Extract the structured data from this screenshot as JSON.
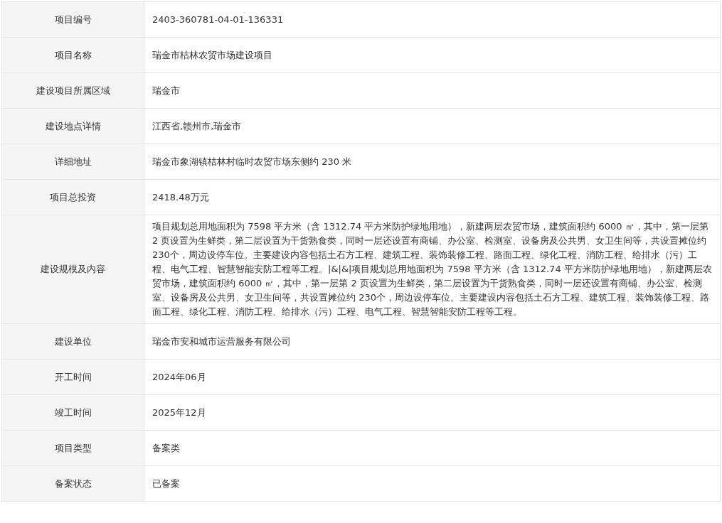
{
  "rows": [
    {
      "label": "项目编号",
      "value": "2403-360781-04-01-136331"
    },
    {
      "label": "项目名称",
      "value": "瑞金市桔林农贸市场建设项目"
    },
    {
      "label": "建设项目所属区域",
      "value": "瑞金市"
    },
    {
      "label": "建设地点详情",
      "value": "江西省,赣州市,瑞金市"
    },
    {
      "label": "详细地址",
      "value": "瑞金市象湖镇桔林村临时农贸市场东侧约 230 米"
    },
    {
      "label": "项目总投资",
      "value": "2418.48万元"
    },
    {
      "label": "建设规模及内容",
      "value": "项目规划总用地面积为 7598 平方米（含 1312.74 平方米防护绿地用地），新建两层农贸市场，建筑面积约 6000 ㎡，其中，第一层第 2 页设置为生鲜类，第二层设置为干货熟食类，同时一层还设置有商铺、办公室、检测室、设备房及公共男、女卫生间等，共设置摊位约 230个，周边设停车位。主要建设内容包括土石方工程、建筑工程、装饰装修工程、路面工程、绿化工程、消防工程、给排水（污）工程、电气工程、智慧智能安防工程等工程。|&|&|项目规划总用地面积为 7598 平方米（含 1312.74 平方米防护绿地用地），新建两层农贸市场，建筑面积约 6000 ㎡，其中，第一层第 2 页设置为生鲜类，第二层设置为干货熟食类，同时一层还设置有商铺、办公室、检测室、设备房及公共男、女卫生间等，共设置摊位约 230个，周边设停车位。主要建设内容包括土石方工程、建筑工程、装饰装修工程、路面工程、绿化工程、消防工程、给排水（污）工程、电气工程、智慧智能安防工程等工程。"
    },
    {
      "label": "建设单位",
      "value": "瑞金市安和城市运营服务有限公司"
    },
    {
      "label": "开工时间",
      "value": "2024年06月"
    },
    {
      "label": "竣工时间",
      "value": "2025年12月"
    },
    {
      "label": "项目类型",
      "value": "备案类"
    },
    {
      "label": "备案状态",
      "value": "已备案"
    }
  ]
}
